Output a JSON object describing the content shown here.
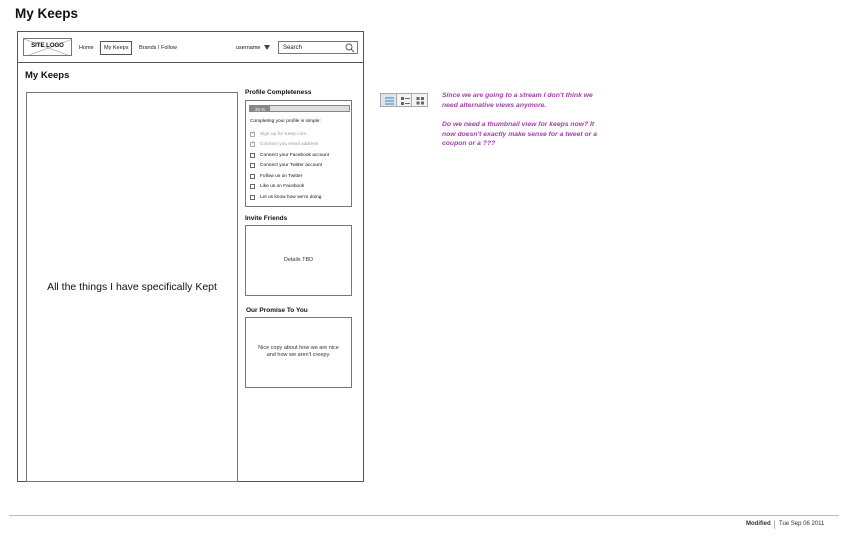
{
  "doc": {
    "title": "My Keeps"
  },
  "nav": {
    "logo": "SITE LOGO",
    "links": [
      "Home",
      "My Keeps",
      "Brands I Follow"
    ],
    "active_link": "My Keeps",
    "username": "username",
    "search_placeholder": "Search"
  },
  "page": {
    "heading": "My Keeps"
  },
  "main": {
    "text": "All the things I have specifically Kept"
  },
  "profile": {
    "heading": "Profile Completeness",
    "progress_label": "20 %",
    "progress_fraction": 0.2,
    "intro": "Completing your profile is simple:",
    "items": [
      {
        "label": "Sign up for Keep.com",
        "done": true
      },
      {
        "label": "Connect you email address",
        "done": true
      },
      {
        "label": "Connect your Facebook account",
        "done": false
      },
      {
        "label": "Connect your Twitter account",
        "done": false
      },
      {
        "label": "Follow us on Twitter",
        "done": false
      },
      {
        "label": "Like us on Facebook",
        "done": false
      },
      {
        "label": "Let us know how we're doing",
        "done": false
      }
    ]
  },
  "invite": {
    "heading": "Invite Friends",
    "body": "Details TBD"
  },
  "promise": {
    "heading": "Our Promise To You",
    "line1": "Nice copy about how we are nice",
    "line2": "and how we aren't creepy."
  },
  "view_toggle": {
    "options": [
      "list-view-icon",
      "detail-view-icon",
      "grid-view-icon"
    ],
    "selected": "list-view-icon"
  },
  "notes": [
    "Since we are going to a stream I don't think we need alternative views anymore.",
    "Do we need a thumbnail view for keeps now? It now doesn't exactly make sense for a tweet or a coupon or a ???"
  ],
  "colors": {
    "note": "#a13fa8",
    "toggle_active": "#d7e6f3"
  },
  "footer": {
    "modified_label": "Modified",
    "date": "Tue Sep 06 2011"
  }
}
